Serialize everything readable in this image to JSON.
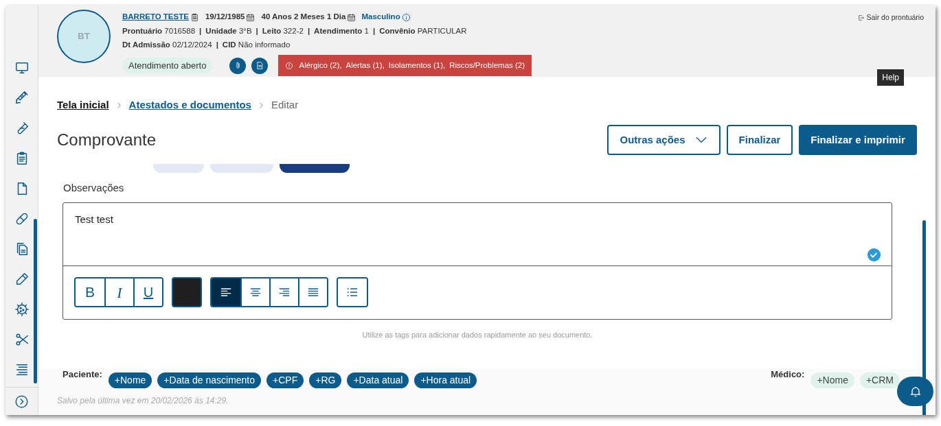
{
  "sidebar": {
    "items": [
      {
        "selected": false
      },
      {
        "selected": false
      },
      {
        "selected": false
      },
      {
        "selected": false
      },
      {
        "selected": false
      },
      {
        "selected": false
      },
      {
        "selected": false
      },
      {
        "selected": false
      },
      {
        "selected": false
      },
      {
        "selected": false
      },
      {
        "selected": false
      }
    ]
  },
  "patient": {
    "initials": "BT",
    "name": "BARRETO TESTE",
    "birth_date": "19/12/1985",
    "age": "40 Anos 2 Meses 1 Dia",
    "sex": "Masculino",
    "separator": "|",
    "details": [
      {
        "label": "Prontuário",
        "value": "7016588"
      },
      {
        "label": "Unidade",
        "value": "3°B"
      },
      {
        "label": "Leito",
        "value": "322-2"
      },
      {
        "label": "Atendimento",
        "value": "1"
      },
      {
        "label": "Convênio",
        "value": "PARTICULAR"
      }
    ],
    "details_2": [
      {
        "label": "Dt Admissão",
        "value": "02/12/2024"
      },
      {
        "label": "CID",
        "value": "Não informado"
      }
    ],
    "status": "Atendimento aberto",
    "alerts": [
      "Alérgico (2),",
      "Alertas (1),",
      "Isolamentos (1),",
      "Riscos/Problemas (2)"
    ]
  },
  "exit_link": "Sair do prontuário",
  "tooltip": "Help",
  "breadcrumb": [
    {
      "label": "Tela inicial",
      "link": true
    },
    {
      "label": "Atestados e documentos",
      "link": true
    },
    {
      "label": "Editar",
      "link": false
    }
  ],
  "title": "Comprovante",
  "actions": [
    {
      "label": "Outras ações",
      "kind": "dropdown"
    },
    {
      "label": "Finalizar",
      "kind": "outline"
    },
    {
      "label": "Finalizar e imprimir",
      "kind": "primary"
    }
  ],
  "document_type": {
    "options": [
      {
        "selected": false
      },
      {
        "selected": false
      },
      {
        "selected": true
      }
    ]
  },
  "observations": {
    "label": "Observações",
    "value": "Test test",
    "valid": true
  },
  "toolbar": [
    {
      "kind": "group",
      "buttons": [
        {
          "kind": "bold",
          "text": "B",
          "selected": false
        },
        {
          "kind": "italic",
          "text": "I",
          "selected": false
        },
        {
          "kind": "underline",
          "text": "U",
          "selected": false
        }
      ]
    },
    {
      "kind": "color",
      "color": "#1f1f1f"
    },
    {
      "kind": "group",
      "buttons": [
        {
          "kind": "align-left",
          "selected": true
        },
        {
          "kind": "align-center",
          "selected": false
        },
        {
          "kind": "align-right",
          "selected": false
        },
        {
          "kind": "align-justify",
          "selected": false
        }
      ]
    },
    {
      "kind": "group",
      "buttons": [
        {
          "kind": "list",
          "selected": false
        }
      ]
    }
  ],
  "tags_hint": "Utilize as tags para adicionar dados rapidamente ao seu documento.",
  "patient_tags": {
    "label": "Paciente:",
    "tags": [
      "+Nome",
      "+Data de nascimento",
      "+CPF",
      "+RG",
      "+Data atual",
      "+Hora atual"
    ]
  },
  "doctor_tags": {
    "label": "Médico:",
    "tags": [
      "+Nome",
      "+CRM"
    ]
  },
  "saved_note": "Salvo pela última vez em 20/02/2026 às 14:29."
}
